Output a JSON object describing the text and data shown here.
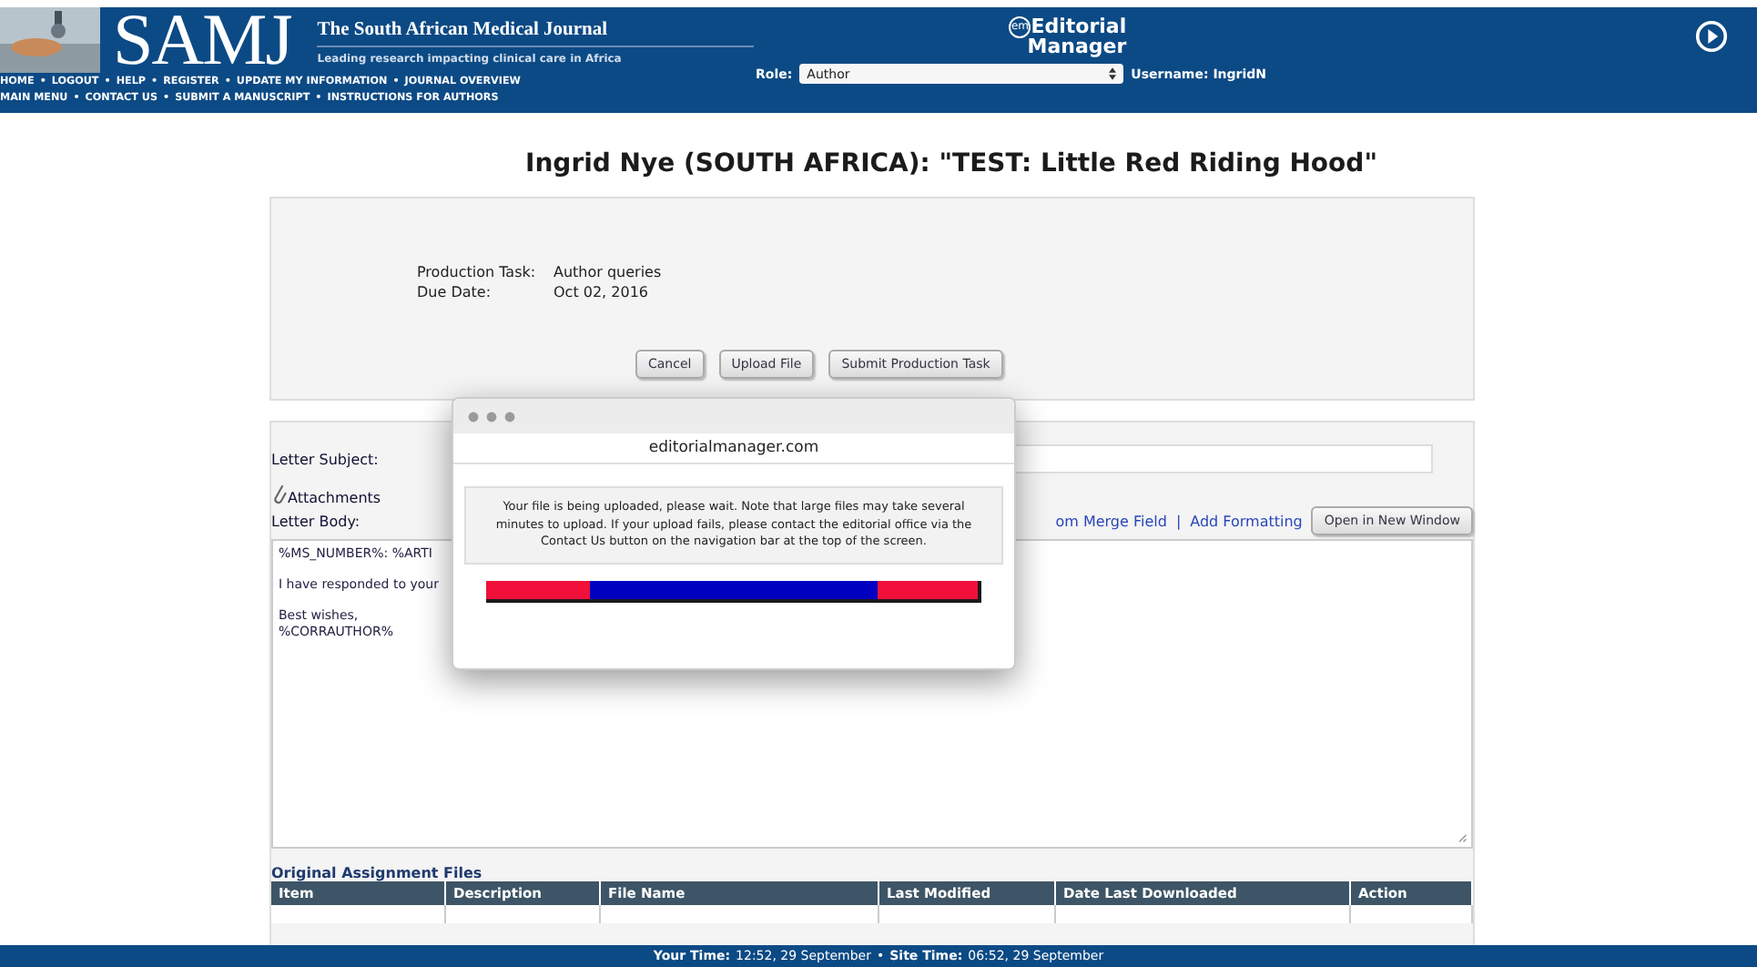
{
  "header": {
    "logo": "SAMJ",
    "journal_name": "The South African Medical Journal",
    "tagline": "Leading research impacting clinical care in Africa",
    "nav_rows": [
      [
        "HOME",
        "LOGOUT",
        "HELP",
        "REGISTER",
        "UPDATE MY INFORMATION",
        "JOURNAL OVERVIEW"
      ],
      [
        "MAIN MENU",
        "CONTACT US",
        "SUBMIT A MANUSCRIPT",
        "INSTRUCTIONS FOR AUTHORS"
      ]
    ],
    "nav_separator": "•",
    "em_badge": "em",
    "em_title": "Editorial",
    "em_subtitle": "Manager",
    "role_label": "Role:",
    "role_value": "Author",
    "username": "Username: IngridN"
  },
  "page_title": "Ingrid Nye (SOUTH AFRICA): \"TEST: Little Red Riding Hood\"",
  "task": {
    "fields": [
      {
        "label": "Production Task:",
        "value": "Author queries"
      },
      {
        "label": "Due Date:",
        "value": "Oct 02, 2016"
      }
    ],
    "buttons": [
      "Cancel",
      "Upload File",
      "Submit Production Task"
    ]
  },
  "letter": {
    "subject_label": "Letter Subject:",
    "attachments": "Attachments",
    "body_label": "Letter Body:",
    "links": [
      "om Merge Field",
      "Add Formatting"
    ],
    "link_separator": "|",
    "open_button": "Open in New Window",
    "body_lines": [
      "%MS_NUMBER%: %ARTI",
      "I have responded to your",
      "Best wishes,\n%CORRAUTHOR%"
    ]
  },
  "files": {
    "title": "Original Assignment Files",
    "columns": [
      "Item",
      "Description",
      "File Name",
      "Last Modified",
      "Date  Last Downloaded",
      "Action"
    ]
  },
  "dialog": {
    "title": "editorialmanager.com",
    "message": "Your file is being uploaded, please wait. Note that large files may take several minutes to upload. If your upload fails, please contact the editorial office via the Contact Us button on the navigation bar at the top of the screen."
  },
  "footer": [
    {
      "label": "Your Time:",
      "value": "12:52, 29 September"
    },
    {
      "label": "Site Time:",
      "value": "06:52, 29 September"
    }
  ],
  "footer_separator": "•"
}
